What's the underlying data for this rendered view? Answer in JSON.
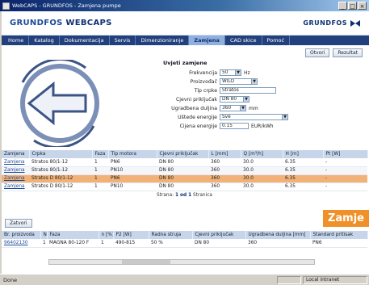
{
  "window": {
    "title": "WebCAPS - GRUNDFOS - Zamjena pumpe"
  },
  "header": {
    "brand_prefix": "GRUNDFOS ",
    "brand_suffix": "WEBCAPS",
    "logo_text": "GRUNDFOS"
  },
  "nav": [
    {
      "label": "Home"
    },
    {
      "label": "Katalog"
    },
    {
      "label": "Dokumentacija"
    },
    {
      "label": "Servis"
    },
    {
      "label": "Dimenzioniranje"
    },
    {
      "label": "Zamjena",
      "active": true
    },
    {
      "label": "CAD skice"
    },
    {
      "label": "Pomoć"
    }
  ],
  "toolbar": {
    "btn1": "Otvori",
    "btn2": "Rezultat"
  },
  "form": {
    "title": "Uvjeti zamjene",
    "rows": [
      {
        "label": "Frekvencija",
        "value": "50",
        "unit": "Hz",
        "type": "select"
      },
      {
        "label": "Proizvođač",
        "value": "WILO",
        "unit": "",
        "type": "select"
      },
      {
        "label": "Tip crpke",
        "value": "Stratos",
        "unit": "",
        "type": "input"
      },
      {
        "label": "Cjevni priključak",
        "value": "DN 80",
        "unit": "",
        "type": "select"
      },
      {
        "label": "Ugradbena duljina",
        "value": "360",
        "unit": "mm",
        "type": "select"
      },
      {
        "label": "Uštede energije",
        "value": "Sve",
        "unit": "",
        "type": "select"
      },
      {
        "label": "Cijena energije",
        "value": "0.15",
        "unit": "EUR/kWh",
        "type": "input"
      }
    ]
  },
  "grid": {
    "headers": [
      "Zamjena",
      "Crpka",
      "Faza",
      "Tip motora",
      "Cjevni priključak",
      "L [mm]",
      "Q [m³/h]",
      "H [m]",
      "Pt [W]"
    ],
    "rows": [
      {
        "cells": [
          "Zamjena",
          "Stratos 80/1-12",
          "1",
          "PN6",
          "DN 80",
          "360",
          "30.0",
          "6.35",
          "-"
        ],
        "style": ""
      },
      {
        "cells": [
          "Zamjena",
          "Stratos 80/1-12",
          "1",
          "PN10",
          "DN 80",
          "360",
          "30.0",
          "6.35",
          "-"
        ],
        "style": "alt"
      },
      {
        "cells": [
          "Zamjena",
          "Stratos D 80/1-12",
          "1",
          "PN6",
          "DN 80",
          "360",
          "30.0",
          "6.35",
          "-"
        ],
        "style": "hl"
      },
      {
        "cells": [
          "Zamjena",
          "Stratos D 80/1-12",
          "1",
          "PN10",
          "DN 80",
          "360",
          "30.0",
          "6.35",
          "-"
        ],
        "style": ""
      }
    ],
    "pager": {
      "prefix": "Strana: ",
      "current": "1 od 1",
      "suffix": " Stranica"
    }
  },
  "overlay": {
    "text": "Zamje"
  },
  "close": {
    "label": "Zatvori"
  },
  "grid2": {
    "headers": [
      "Br. proizvoda",
      "Naziv proizvoda",
      "Faza",
      "n [%]",
      "P2 [W]",
      "Radna struja",
      "Cjevni priključak",
      "Ugradbena duljina [mm]",
      "Standard pritisak"
    ],
    "rows": [
      {
        "cells": [
          "96402130",
          "1",
          "MAGNA 80-120 F",
          "1",
          "490-815",
          "50 %",
          "DN 80",
          "360",
          "PN6"
        ]
      }
    ]
  },
  "status": {
    "text": "Done",
    "zone": "Local intranet"
  }
}
